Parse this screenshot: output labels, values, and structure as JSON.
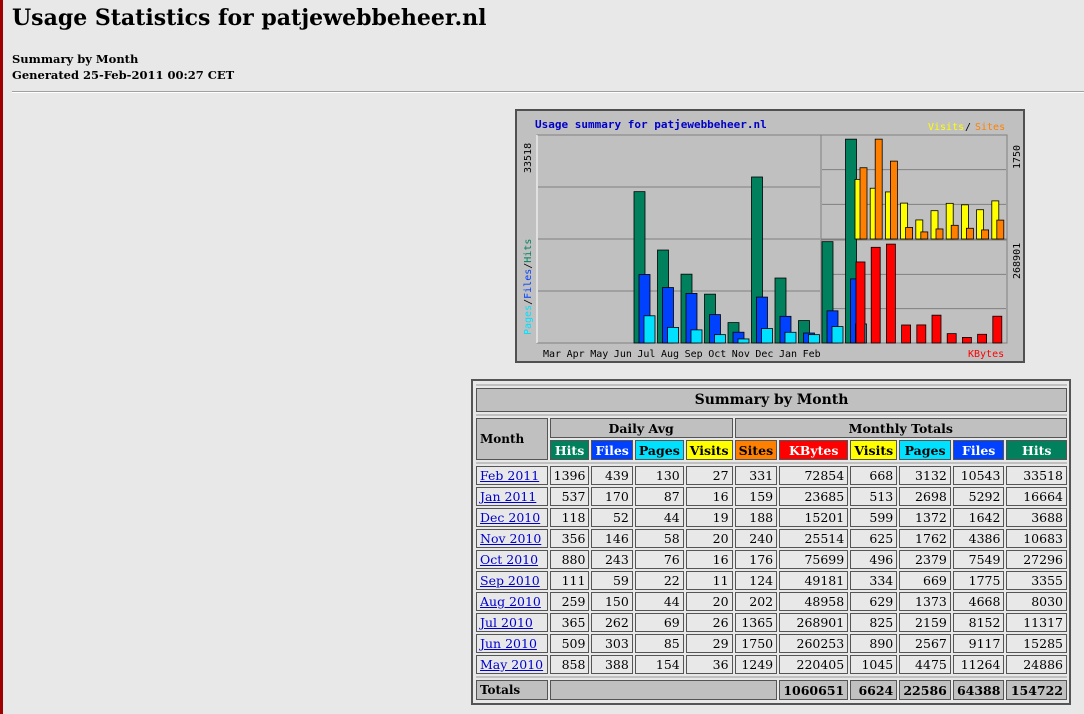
{
  "page": {
    "title": "Usage Statistics for patjewebbeheer.nl",
    "subtitle": "Summary by Month",
    "generated": "Generated 25-Feb-2011 00:27 CET"
  },
  "graph": {
    "title": "Usage summary for patjewebbeheer.nl",
    "legend_visits": "Visits",
    "legend_slash": "/",
    "legend_sites": "Sites",
    "left_ylabel_pages": "Pages",
    "left_ylabel_files": "Files",
    "left_ylabel_hits": "Hits",
    "left_max": "33518",
    "right_top_max": "1750",
    "right_bottom_max": "268901",
    "kbytes_label": "KBytes",
    "colors": {
      "hits": "#00805c",
      "files": "#0040ff",
      "pages": "#00e0ff",
      "visits": "#ffff00",
      "sites": "#ff8000",
      "kbytes": "#ff0000"
    }
  },
  "chart_data": {
    "type": "bar",
    "categories": [
      "Mar",
      "Apr",
      "May",
      "Jun",
      "Jul",
      "Aug",
      "Sep",
      "Oct",
      "Nov",
      "Dec",
      "Jan",
      "Feb"
    ],
    "series": [
      {
        "name": "Hits",
        "values": [
          0,
          0,
          24886,
          15285,
          11317,
          8030,
          3355,
          27296,
          10683,
          3688,
          16664,
          33518
        ]
      },
      {
        "name": "Files",
        "values": [
          0,
          0,
          11264,
          9117,
          8152,
          4668,
          1775,
          7549,
          4386,
          1642,
          5292,
          10543
        ]
      },
      {
        "name": "Pages",
        "values": [
          0,
          0,
          4475,
          2567,
          2159,
          1373,
          669,
          2379,
          1762,
          1372,
          2698,
          3132
        ]
      },
      {
        "name": "Visits",
        "values": [
          0,
          0,
          1045,
          890,
          825,
          629,
          334,
          496,
          625,
          599,
          513,
          668
        ]
      },
      {
        "name": "Sites",
        "values": [
          0,
          0,
          1249,
          1750,
          1365,
          202,
          124,
          176,
          240,
          188,
          159,
          331
        ]
      },
      {
        "name": "KBytes",
        "values": [
          0,
          0,
          220405,
          260253,
          268901,
          48958,
          49181,
          75699,
          25514,
          15201,
          23685,
          72854
        ]
      }
    ]
  },
  "table": {
    "title": "Summary by Month",
    "col_month": "Month",
    "group_daily": "Daily Avg",
    "group_monthly": "Monthly Totals",
    "daily_headers": [
      "Hits",
      "Files",
      "Pages",
      "Visits"
    ],
    "monthly_headers": [
      "Sites",
      "KBytes",
      "Visits",
      "Pages",
      "Files",
      "Hits"
    ],
    "rows": [
      {
        "month": "Feb 2011",
        "d_hits": "1396",
        "d_files": "439",
        "d_pages": "130",
        "d_visits": "27",
        "sites": "331",
        "kbytes": "72854",
        "visits": "668",
        "pages": "3132",
        "files": "10543",
        "hits": "33518"
      },
      {
        "month": "Jan 2011",
        "d_hits": "537",
        "d_files": "170",
        "d_pages": "87",
        "d_visits": "16",
        "sites": "159",
        "kbytes": "23685",
        "visits": "513",
        "pages": "2698",
        "files": "5292",
        "hits": "16664"
      },
      {
        "month": "Dec 2010",
        "d_hits": "118",
        "d_files": "52",
        "d_pages": "44",
        "d_visits": "19",
        "sites": "188",
        "kbytes": "15201",
        "visits": "599",
        "pages": "1372",
        "files": "1642",
        "hits": "3688"
      },
      {
        "month": "Nov 2010",
        "d_hits": "356",
        "d_files": "146",
        "d_pages": "58",
        "d_visits": "20",
        "sites": "240",
        "kbytes": "25514",
        "visits": "625",
        "pages": "1762",
        "files": "4386",
        "hits": "10683"
      },
      {
        "month": "Oct 2010",
        "d_hits": "880",
        "d_files": "243",
        "d_pages": "76",
        "d_visits": "16",
        "sites": "176",
        "kbytes": "75699",
        "visits": "496",
        "pages": "2379",
        "files": "7549",
        "hits": "27296"
      },
      {
        "month": "Sep 2010",
        "d_hits": "111",
        "d_files": "59",
        "d_pages": "22",
        "d_visits": "11",
        "sites": "124",
        "kbytes": "49181",
        "visits": "334",
        "pages": "669",
        "files": "1775",
        "hits": "3355"
      },
      {
        "month": "Aug 2010",
        "d_hits": "259",
        "d_files": "150",
        "d_pages": "44",
        "d_visits": "20",
        "sites": "202",
        "kbytes": "48958",
        "visits": "629",
        "pages": "1373",
        "files": "4668",
        "hits": "8030"
      },
      {
        "month": "Jul 2010",
        "d_hits": "365",
        "d_files": "262",
        "d_pages": "69",
        "d_visits": "26",
        "sites": "1365",
        "kbytes": "268901",
        "visits": "825",
        "pages": "2159",
        "files": "8152",
        "hits": "11317"
      },
      {
        "month": "Jun 2010",
        "d_hits": "509",
        "d_files": "303",
        "d_pages": "85",
        "d_visits": "29",
        "sites": "1750",
        "kbytes": "260253",
        "visits": "890",
        "pages": "2567",
        "files": "9117",
        "hits": "15285"
      },
      {
        "month": "May 2010",
        "d_hits": "858",
        "d_files": "388",
        "d_pages": "154",
        "d_visits": "36",
        "sites": "1249",
        "kbytes": "220405",
        "visits": "1045",
        "pages": "4475",
        "files": "11264",
        "hits": "24886"
      }
    ],
    "totals_label": "Totals",
    "totals": {
      "kbytes": "1060651",
      "visits": "6624",
      "pages": "22586",
      "files": "64388",
      "hits": "154722"
    }
  }
}
